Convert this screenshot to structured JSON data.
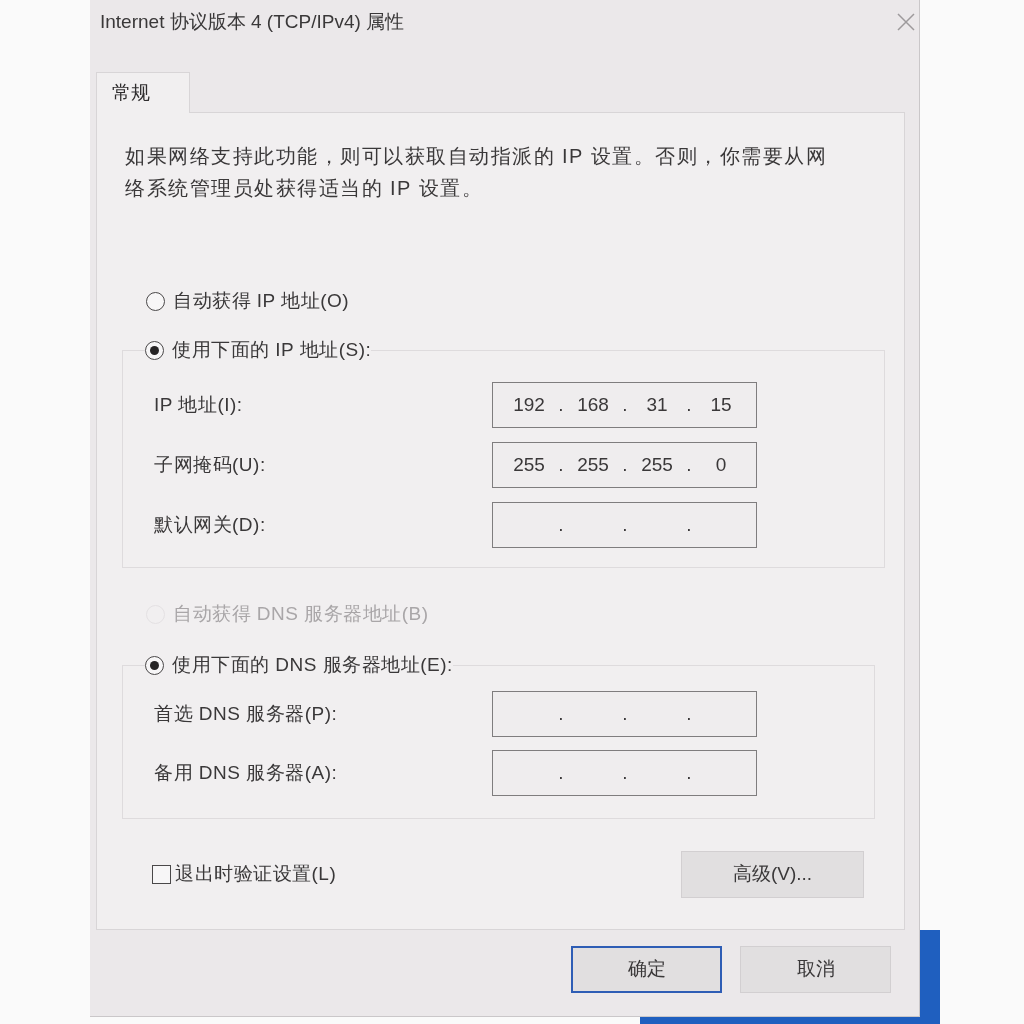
{
  "window": {
    "title": "Internet 协议版本 4 (TCP/IPv4) 属性"
  },
  "tabs": [
    {
      "label": "常规",
      "selected": true
    }
  ],
  "description": "如果网络支持此功能，则可以获取自动指派的 IP 设置。否则，你需要从网络系统管理员处获得适当的 IP 设置。",
  "ip_address": {
    "auto_option": {
      "label": "自动获得 IP 地址(O)",
      "selected": false,
      "disabled": false
    },
    "manual_option": {
      "label": "使用下面的 IP 地址(S):",
      "selected": true,
      "disabled": false
    },
    "fields": [
      {
        "label": "IP 地址(I):",
        "octets": [
          "192",
          "168",
          "31",
          "15"
        ],
        "dots": [
          ".",
          ".",
          "."
        ]
      },
      {
        "label": "子网掩码(U):",
        "octets": [
          "255",
          "255",
          "255",
          "0"
        ],
        "dots": [
          ".",
          ".",
          "."
        ]
      },
      {
        "label": "默认网关(D):",
        "dots": [
          ".",
          ".",
          "."
        ]
      }
    ]
  },
  "dns_server": {
    "auto_option": {
      "label": "自动获得 DNS 服务器地址(B)",
      "selected": false,
      "disabled": true
    },
    "manual_option": {
      "label": "使用下面的 DNS 服务器地址(E):",
      "selected": true,
      "disabled": false
    },
    "fields": [
      {
        "label": "首选 DNS 服务器(P):",
        "dots": [
          ".",
          ".",
          "."
        ]
      },
      {
        "label": "备用 DNS 服务器(A):",
        "dots": [
          ".",
          ".",
          "."
        ]
      }
    ]
  },
  "validate_on_exit": {
    "label": "退出时验证设置(L)",
    "checked": false
  },
  "advanced_button": "高级(V)...",
  "buttons": [
    {
      "label": "确定",
      "default": true
    },
    {
      "label": "取消",
      "default": false
    }
  ]
}
